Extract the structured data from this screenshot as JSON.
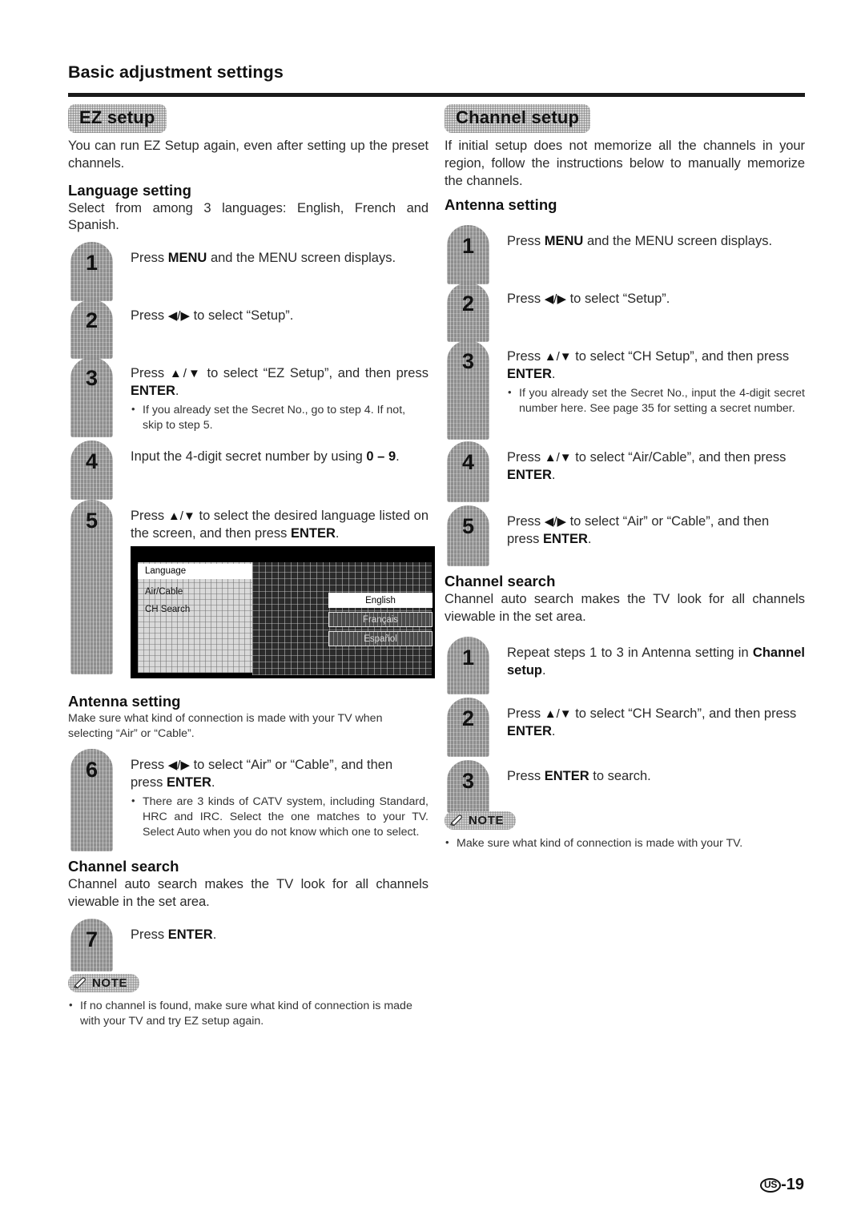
{
  "page": {
    "title": "Basic adjustment settings",
    "footer_region": "US",
    "footer_page": "-19"
  },
  "left_column": {
    "section_pill": "EZ setup",
    "intro": "You can run EZ Setup again, even after setting up the preset channels.",
    "language_setting": {
      "heading": "Language setting",
      "intro": "Select from among 3 languages: English, French and Spanish."
    },
    "steps": [
      {
        "number": "1",
        "text_parts": [
          "Press ",
          "MENU",
          " and the MENU screen displays."
        ]
      },
      {
        "number": "2",
        "arrows": "◀/▶",
        "text_parts": [
          "Press ",
          "",
          " to select “Setup”."
        ]
      },
      {
        "number": "3",
        "arrows": "▲/▼",
        "text_parts": [
          "Press ",
          "",
          " to select “EZ Setup”, and then press ",
          "ENTER",
          "."
        ],
        "bullet": "If you already set the Secret No., go to step 4. If not, skip to step 5."
      },
      {
        "number": "4",
        "text_parts": [
          "Input the 4-digit secret number by using ",
          "0 – 9",
          "."
        ]
      },
      {
        "number": "5",
        "arrows": "▲/▼",
        "text_parts": [
          "Press ",
          "",
          " to select the desired language listed on the screen, and then press ",
          "ENTER",
          "."
        ]
      }
    ],
    "tv_screenshot": {
      "menu_items": [
        "Language",
        "Air/Cable",
        "CH Search"
      ],
      "selected_menu_item": "Language",
      "options": [
        "English",
        "Français",
        "Español"
      ],
      "selected_option": "English"
    },
    "antenna_setting": {
      "heading": "Antenna setting",
      "intro": "Make sure what kind of connection is made with your TV when selecting “Air” or “Cable”.",
      "step": {
        "number": "6",
        "arrows": "◀/▶",
        "text_parts": [
          "Press ",
          "",
          " to select “Air” or “Cable”, and then press ",
          "ENTER",
          "."
        ],
        "bullet": "There are 3 kinds of CATV system, including Standard, HRC and IRC. Select the one matches to your TV. Select Auto when you do not know which one to select."
      }
    },
    "channel_search": {
      "heading": "Channel search",
      "intro": "Channel auto search makes the TV look for all channels viewable in the set area.",
      "step": {
        "number": "7",
        "text_parts": [
          "Press ",
          "ENTER",
          "."
        ]
      }
    },
    "note": {
      "label": "NOTE",
      "bullet": "If no channel is found, make sure what kind of connection is made with your TV and try EZ setup again."
    }
  },
  "right_column": {
    "section_pill": "Channel setup",
    "intro": "If initial setup does not memorize all the channels in your region, follow the instructions below to manually memorize the channels.",
    "antenna_setting": {
      "heading": "Antenna setting",
      "steps": [
        {
          "number": "1",
          "text_parts": [
            "Press ",
            "MENU",
            " and the MENU screen displays."
          ]
        },
        {
          "number": "2",
          "arrows": "◀/▶",
          "text_parts": [
            "Press ",
            "",
            " to select “Setup”."
          ]
        },
        {
          "number": "3",
          "arrows": "▲/▼",
          "text_parts": [
            "Press ",
            "",
            " to select “CH Setup”, and then press ",
            "ENTER",
            "."
          ],
          "bullet": "If you already set the Secret No., input the 4-digit secret number here. See page 35 for setting a secret number."
        },
        {
          "number": "4",
          "arrows": "▲/▼",
          "text_parts": [
            "Press ",
            "",
            " to select “Air/Cable”, and then press ",
            "ENTER",
            "."
          ]
        },
        {
          "number": "5",
          "arrows": "◀/▶",
          "text_parts": [
            "Press ",
            "",
            " to select “Air” or “Cable”, and then press ",
            "ENTER",
            "."
          ]
        }
      ]
    },
    "channel_search": {
      "heading": "Channel search",
      "intro": "Channel auto search makes the TV look for all channels viewable in the set area.",
      "steps": [
        {
          "number": "1",
          "text_parts": [
            "Repeat steps 1 to 3 in Antenna setting in ",
            "Channel setup",
            "."
          ]
        },
        {
          "number": "2",
          "arrows": "▲/▼",
          "text_parts": [
            "Press ",
            "",
            " to select “CH Search”, and then press ",
            "ENTER",
            "."
          ]
        },
        {
          "number": "3",
          "text_parts": [
            "Press ",
            "ENTER",
            " to search."
          ]
        }
      ]
    },
    "note": {
      "label": "NOTE",
      "bullet": "Make sure what kind of connection is made with your TV."
    }
  }
}
